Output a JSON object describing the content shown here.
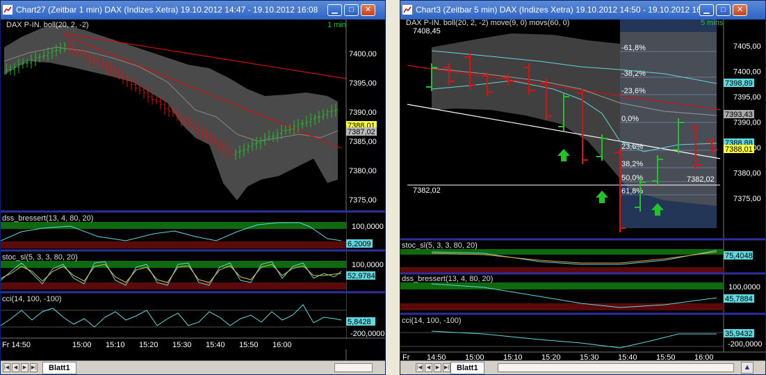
{
  "left_window": {
    "title": "Chart27 (Zeitbar 1 min)   DAX (Indizes Xetra) 19.10.2012 14:47 - 19.10.2012 16:08",
    "price_header": "DAX P-IN. boll(20, 2, -2)",
    "interval": "1 min",
    "price_labels": [
      "7400,00",
      "7395,00",
      "7390,00",
      "7385,00",
      "7380,00",
      "7375,00"
    ],
    "price_tags": [
      "7388,01",
      "7387,02"
    ],
    "dss_header": "dss_bressert(13, 4, 80, 20)",
    "dss_labels": [
      "100,0000",
      "6,2009"
    ],
    "stoc_header": "stoc_sl(5, 3, 3, 80, 20)",
    "stoc_labels": [
      "100,0000",
      "52,9784"
    ],
    "cci_header": "cci(14, 100, -100)",
    "cci_labels": [
      "5,8428",
      "-200,0000"
    ],
    "time_labels": [
      "Fr 14:50",
      "15:00",
      "15:10",
      "15:20",
      "15:30",
      "15:40",
      "15:50",
      "16:00"
    ],
    "sheet_tab": "Blatt1"
  },
  "right_window": {
    "title": "Chart3 (Zeitbar 5 min)   DAX (Indizes Xetra) 19.10.2012 14:50 - 19.10.2012 16:08",
    "price_header": "DAX P-IN. boll(20, 2, -2) move(9, 0) movs(60, 0)",
    "interval": "5 mins",
    "high_label": "7408,45",
    "price_labels": [
      "7405,00",
      "7400,00",
      "7395,00",
      "7390,00",
      "7385,00",
      "7380,00",
      "7375,00"
    ],
    "price_tags": [
      "7398,89",
      "7393,43",
      "7388,88",
      "7388,01"
    ],
    "fib_labels": [
      "-61,8%",
      "-38,2%",
      "-23,6%",
      "0,0%",
      "23,6%",
      "38,2%",
      "50,0%",
      "61,8%"
    ],
    "level_left": "7382,02",
    "level_right": "7382,02",
    "stoc_header": "stoc_sl(5, 3, 3, 80, 20)",
    "stoc_labels": [
      "75,4048"
    ],
    "dss_header": "dss_bressert(13, 4, 80, 20)",
    "dss_labels": [
      "100,0000",
      "45,7884"
    ],
    "cci_header": "cci(14, 100, -100)",
    "cci_labels": [
      "35,9432",
      "-200,0000"
    ],
    "time_labels": [
      "Fr",
      "14:50",
      "15:00",
      "15:10",
      "15:20",
      "15:30",
      "15:40",
      "15:50",
      "16:00"
    ],
    "sheet_tab": "Blatt1"
  },
  "colors": {
    "up": "#22c22a",
    "down": "#e01010",
    "band": "#5a5a5a",
    "panel_green": "#0f6a0f",
    "panel_red": "#5a0a0a",
    "axis_bg": "#000000"
  }
}
